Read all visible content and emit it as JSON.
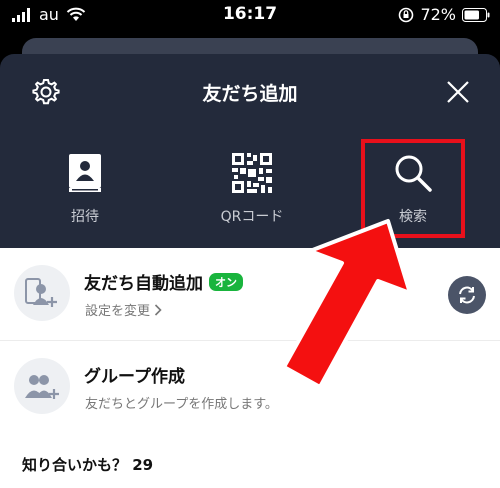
{
  "status_bar": {
    "carrier": "au",
    "time": "16:17",
    "battery": "72%"
  },
  "header": {
    "title": "友だち追加"
  },
  "actions": [
    {
      "label": "招待",
      "icon": "contacts-book-icon"
    },
    {
      "label": "QRコード",
      "icon": "qr-code-icon"
    },
    {
      "label": "検索",
      "icon": "search-icon"
    }
  ],
  "rows": {
    "auto_add": {
      "title": "友だち自動追加",
      "badge": "オン",
      "subtitle": "設定を変更"
    },
    "group": {
      "title": "グループ作成",
      "subtitle": "友だちとグループを作成します。"
    }
  },
  "section": {
    "label": "知り合いかも？ 29"
  },
  "colors": {
    "header_bg": "#232a3b",
    "highlight": "#e8101b",
    "badge_green": "#19b43d"
  }
}
